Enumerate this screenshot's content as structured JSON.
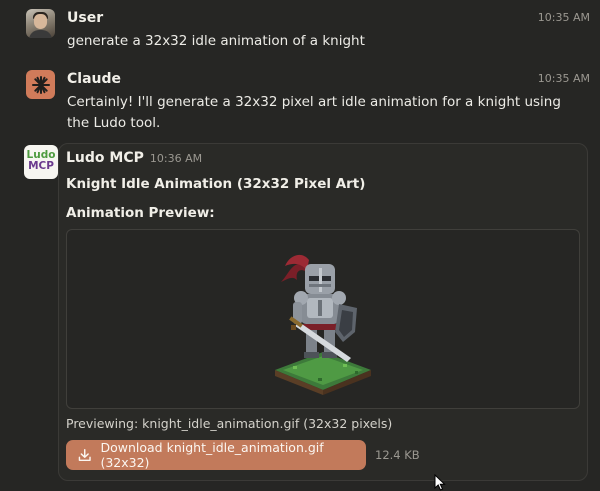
{
  "messages": [
    {
      "sender": "User",
      "time": "10:35 AM",
      "text": "generate a 32x32 idle animation of a knight",
      "avatar_icon": "user-photo-icon"
    },
    {
      "sender": "Claude",
      "time": "10:35 AM",
      "text": "Certainly! I'll generate a 32x32 pixel art idle animation for a knight using the Ludo tool.",
      "avatar_icon": "claude-logo-icon",
      "avatar_color": "#d07b5a"
    }
  ],
  "tool_result": {
    "logo_line1": "Ludo",
    "logo_line2": "MCP",
    "tool_name": "Ludo MCP",
    "time": "10:36 AM",
    "title": "Knight Idle Animation (32x32 Pixel Art)",
    "preview_label": "Animation Preview:",
    "preview_image_icon": "pixel-knight-sprite-icon",
    "caption": "Previewing: knight_idle_animation.gif (32x32 pixels)",
    "download_label": "Download knight_idle_animation.gif (32x32)",
    "download_icon": "download-icon",
    "file_size": "12.4 KB",
    "accent_color": "#c27a5b"
  }
}
